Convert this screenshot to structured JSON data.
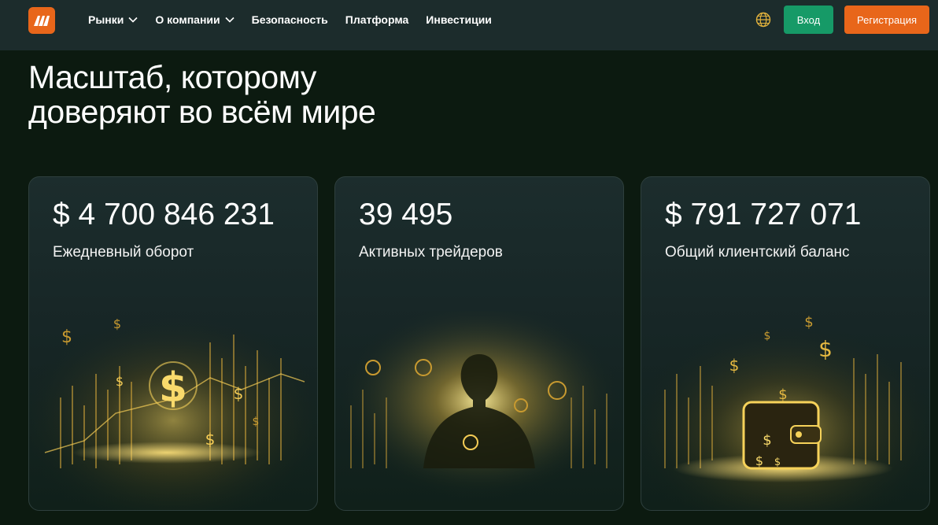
{
  "header": {
    "logo_icon": "brand-m-logo",
    "nav": [
      {
        "label": "Рынки",
        "has_dropdown": true
      },
      {
        "label": "О компании",
        "has_dropdown": true
      },
      {
        "label": "Безопасность",
        "has_dropdown": false
      },
      {
        "label": "Платформа",
        "has_dropdown": false
      },
      {
        "label": "Инвестиции",
        "has_dropdown": false
      }
    ],
    "language_icon": "globe-icon",
    "login_label": "Вход",
    "register_label": "Регистрация"
  },
  "hero": {
    "title_line1": "Масштаб, которому",
    "title_line2": "доверяют во всём мире"
  },
  "stats": [
    {
      "value": "$ 4 700 846 231",
      "label": "Ежедневный оборот",
      "illustration": "gold-dollar-coins-chart"
    },
    {
      "value": "39 495",
      "label": "Активных трейдеров",
      "illustration": "glowing-trader-silhouette"
    },
    {
      "value": "$ 791 727 071",
      "label": "Общий клиентский баланс",
      "illustration": "golden-wallet-with-coins"
    }
  ],
  "colors": {
    "background": "#0c1a10",
    "header": "#1c2c2c",
    "brand_orange": "#e8661a",
    "login_green": "#169a67",
    "gold": "#f0c24a"
  }
}
